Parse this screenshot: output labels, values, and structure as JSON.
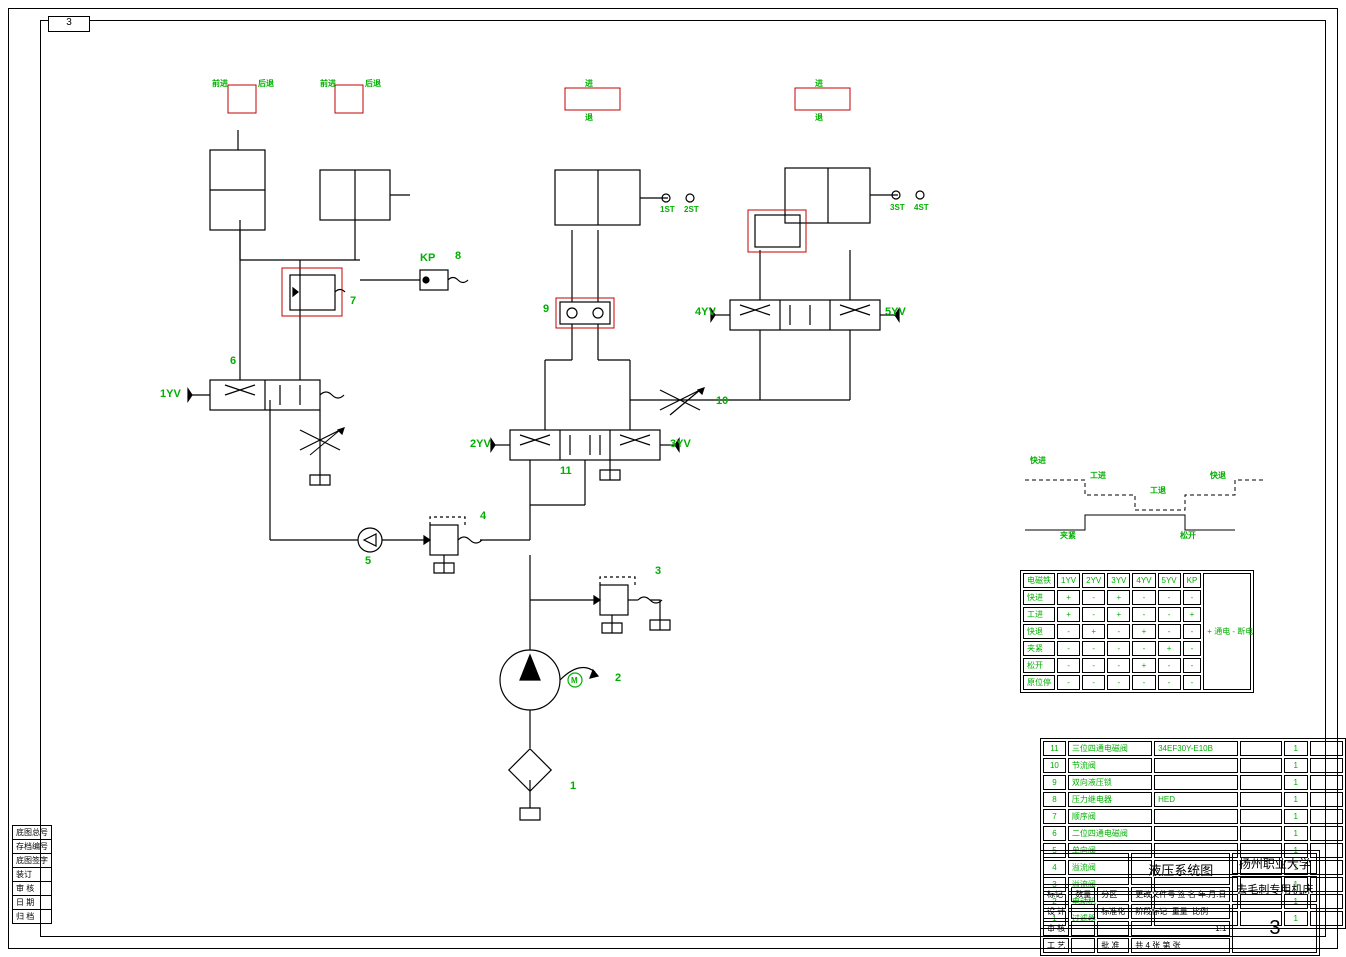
{
  "page_tab": "3",
  "annotations": {
    "n1": "1",
    "n2": "2",
    "n3": "3",
    "n4": "4",
    "n5": "5",
    "n6": "6",
    "n7": "7",
    "n8": "8",
    "n9": "9",
    "n10": "10",
    "n11": "11",
    "yv1": "1YV",
    "yv2": "2YV",
    "yv3": "3YV",
    "yv4": "4YV",
    "yv5": "5YV",
    "kp": "KP",
    "st1": "1ST",
    "st2": "2ST",
    "st3": "3ST",
    "st4": "4ST",
    "m": "M",
    "top1a": "前进",
    "top1b": "后退",
    "top2a": "前进",
    "top2b": "后退",
    "top3a": "进",
    "top3b": "退",
    "top4a": "进",
    "top4b": "退"
  },
  "cycle": {
    "a": "快进",
    "b": "工进",
    "c": "工退",
    "d": "快退",
    "e": "夹紧",
    "f": "松开"
  },
  "solenoid_table": {
    "header": [
      "电磁铁",
      "1YV",
      "2YV",
      "3YV",
      "4YV",
      "5YV",
      "KP"
    ],
    "rows": [
      {
        "name": "快进",
        "cells": [
          "+",
          "-",
          "+",
          "-",
          "-",
          "-"
        ]
      },
      {
        "name": "工进",
        "cells": [
          "+",
          "-",
          "+",
          "-",
          "-",
          "+"
        ]
      },
      {
        "name": "快退",
        "cells": [
          "-",
          "+",
          "-",
          "+",
          "-",
          "-"
        ]
      },
      {
        "name": "夹紧",
        "cells": [
          "-",
          "-",
          "-",
          "-",
          "+",
          "-"
        ]
      },
      {
        "name": "松开",
        "cells": [
          "-",
          "-",
          "-",
          "+",
          "-",
          "-"
        ]
      },
      {
        "name": "原位停",
        "cells": [
          "-",
          "-",
          "-",
          "-",
          "-",
          "-"
        ]
      }
    ],
    "note": "+ 通电  - 断电"
  },
  "bom": {
    "rows": [
      {
        "no": "11",
        "name": "三位四通电磁阀",
        "model": "34EF30Y-E10B",
        "qty": "1"
      },
      {
        "no": "10",
        "name": "节流阀",
        "model": "",
        "qty": "1"
      },
      {
        "no": "9",
        "name": "双向液压锁",
        "model": "",
        "qty": "1"
      },
      {
        "no": "8",
        "name": "压力继电器",
        "model": "HED",
        "qty": "1"
      },
      {
        "no": "7",
        "name": "顺序阀",
        "model": "",
        "qty": "1"
      },
      {
        "no": "6",
        "name": "二位四通电磁阀",
        "model": "",
        "qty": "1"
      },
      {
        "no": "5",
        "name": "单向阀",
        "model": "",
        "qty": "1"
      },
      {
        "no": "4",
        "name": "溢流阀",
        "model": "",
        "qty": "1"
      },
      {
        "no": "3",
        "name": "溢流阀",
        "model": "",
        "qty": "1"
      },
      {
        "no": "2",
        "name": "电动机",
        "model": "",
        "qty": "1"
      },
      {
        "no": "1",
        "name": "过滤器",
        "model": "",
        "qty": "1"
      }
    ]
  },
  "titleblock": {
    "drawing": "液压系统图",
    "org": "扬州职业大学",
    "product": "去毛刺专用机床",
    "sheet": "3",
    "scale_l": "比例",
    "scale_v": "1:1",
    "mark": "标记",
    "qty": "数量",
    "zone": "分区",
    "file": "更改文件号",
    "sign": "签 名",
    "date": "年.月.日",
    "des": "设 计",
    "chk": "审 核",
    "std": "标准化",
    "app": "批 准",
    "tech": "工 艺",
    "stage": "阶段标记",
    "wt": "重量",
    "sheets": "共 4 张  第    张"
  },
  "sidebar": {
    "r": [
      "底图总号",
      "存档编号",
      "底图签字",
      "装订",
      "审 核",
      "日 期",
      "归 档"
    ]
  }
}
